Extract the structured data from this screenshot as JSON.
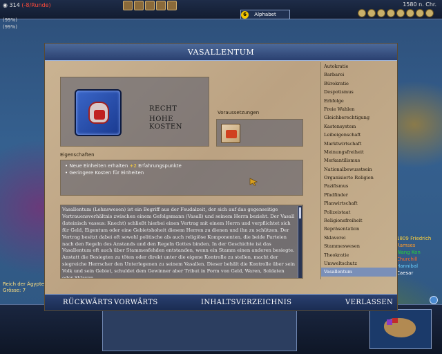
{
  "hud": {
    "gold": "314",
    "gold_change": "(-8/Runde)",
    "stat_line1": "(99%)",
    "stat_line2": "(99%)",
    "research_count": "6",
    "research_label": "Alphabet",
    "date": "1580 n. Chr."
  },
  "players": [
    {
      "score": "1809",
      "name": "Friedrich"
    },
    {
      "score": "",
      "name": "Ramses"
    },
    {
      "score": "",
      "name": "Wang Kon"
    },
    {
      "score": "",
      "name": "Churchill"
    },
    {
      "score": "",
      "name": "Hannibal"
    },
    {
      "score": "",
      "name": "Caesar"
    }
  ],
  "city": {
    "name": "Reich der Ägypter",
    "info": "Grösse: 7"
  },
  "pedia": {
    "title": "VASALLENTUM",
    "header_line1": "RECHT",
    "header_line2": "HOHE KOSTEN",
    "requirements_label": "Voraussetzungen",
    "properties_label": "Eigenschaften",
    "properties": [
      {
        "text": "Neue Einheiten erhalten ",
        "bonus": "+2",
        "rest": " Erfahrungspunkte"
      },
      {
        "text": "Geringere Kosten für Einheiten",
        "bonus": "",
        "rest": ""
      }
    ],
    "description": "Vasallentum (Lehnswesen) ist ein Begriff aus der Feudalzeit, der sich auf das gegenseitige Vertrauensverhältnis zwischen einem Gefolgsmann (Vasall) und seinem Herrn bezieht. Der Vasall (lateinisch vassus: Knecht) schließt hierbei einen Vertrag mit einem Herrn und verpflichtet sich für Geld, Eigentum oder eine Gebietshoheit diesem Herren zu dienen und ihn zu schützen. Der Vertrag besitzt dabei oft sowohl politische als auch religiöse Komponenten, die beide Parteien nach den Regeln des Anstands und den Regeln Gottes binden. In der Geschichte ist das Vasallentum oft auch über Stammesfehden entstanden, wenn ein Stamm einen anderen besiegte. Anstatt die Besiegten zu töten oder direkt unter die eigene Kontrolle zu stellen, macht der siegreiche Herrscher den Unterlegenen zu seinem Vasallen. Dieser behält die Kontrolle über sein Volk und sein Gebiet, schuldet dem Gewinner aber Tribut in Form von Geld, Waren, Soldaten oder Sklaven.",
    "civics": [
      "Autokratie",
      "Barbarei",
      "Bürokratie",
      "Despotismus",
      "Erbfolge",
      "Freie Wahlen",
      "Gleichberechtigung",
      "Kastensystem",
      "Leibeigenschaft",
      "Marktwirtschaft",
      "Meinungsfreiheit",
      "Merkantilismus",
      "Nationalbewusstsein",
      "Organisierte Religion",
      "Pazifismus",
      "Pfadfinder",
      "Planwirtschaft",
      "Polizeistaat",
      "Religionsfreiheit",
      "Repräsentation",
      "Sklaverei",
      "Stammeswesen",
      "Theokratie",
      "Umweltschutz",
      "Vasallentum"
    ],
    "selected_index": 24,
    "footer": {
      "back": "RÜCKWÄRTS",
      "forward": "VORWÄRTS",
      "toc": "INHALTSVERZEICHNIS",
      "exit": "VERLASSEN"
    }
  }
}
